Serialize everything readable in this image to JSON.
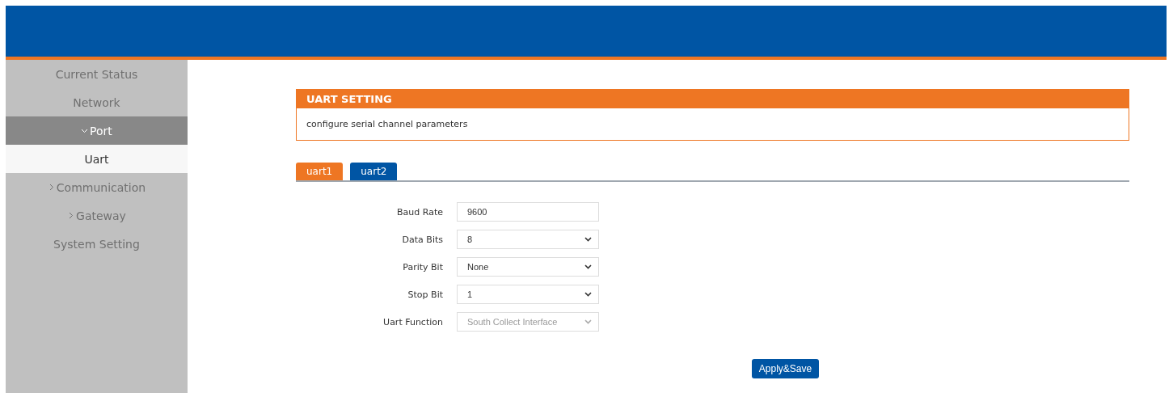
{
  "sidebar": {
    "items": [
      {
        "label": "Current Status",
        "selected": false
      },
      {
        "label": "Network",
        "selected": false
      },
      {
        "label": "Port",
        "selected": false,
        "expanded": true,
        "children": [
          {
            "label": "Uart",
            "selected": true
          }
        ]
      },
      {
        "label": "Communication",
        "selected": false,
        "expanded": false
      },
      {
        "label": "Gateway",
        "selected": false,
        "expanded": false
      },
      {
        "label": "System Setting",
        "selected": false
      }
    ]
  },
  "panel": {
    "title": "UART SETTING",
    "description": "configure serial channel parameters"
  },
  "tabs": [
    {
      "label": "uart1",
      "selected": true
    },
    {
      "label": "uart2",
      "selected": false
    }
  ],
  "form": {
    "fields": [
      {
        "label": "Baud Rate",
        "kind": "input",
        "value": "9600",
        "disabled": false
      },
      {
        "label": "Data Bits",
        "kind": "select",
        "value": "8",
        "disabled": false
      },
      {
        "label": "Parity Bit",
        "kind": "select",
        "value": "None",
        "disabled": false
      },
      {
        "label": "Stop Bit",
        "kind": "select",
        "value": "1",
        "disabled": false
      },
      {
        "label": "Uart Function",
        "kind": "select",
        "value": "South Collect Interface",
        "disabled": true
      }
    ]
  },
  "button": "Apply&Save"
}
